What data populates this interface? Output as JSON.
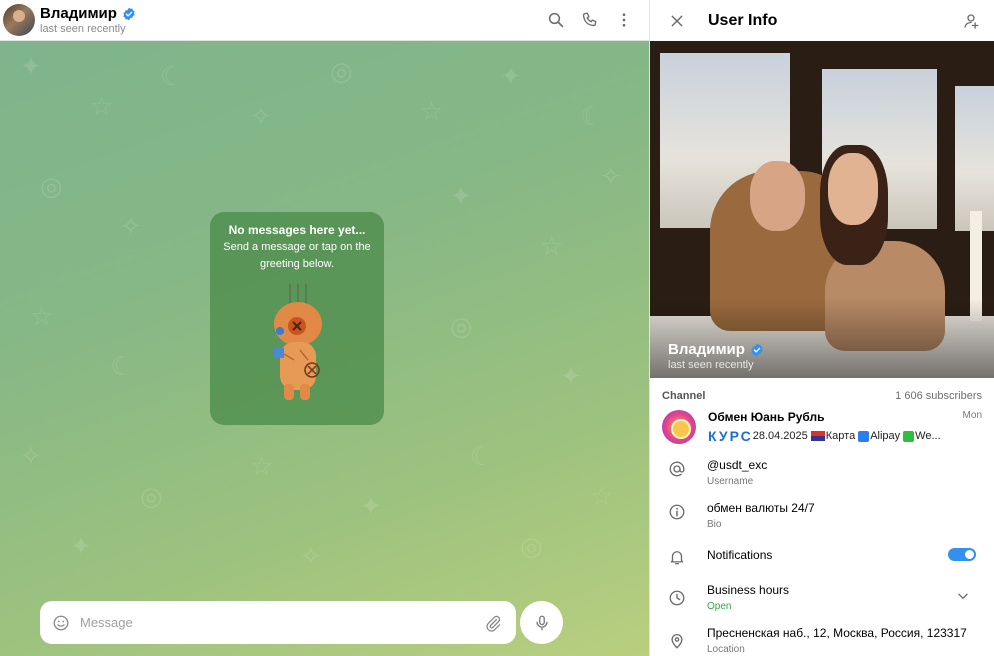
{
  "chat": {
    "name": "Владимир",
    "status": "last seen recently",
    "empty_title": "No messages here yet...",
    "empty_subtitle": "Send a message or tap on the greeting below.",
    "message_placeholder": "Message"
  },
  "info_panel": {
    "title": "User Info",
    "photo_name": "Владимир",
    "photo_status": "last seen recently",
    "channel": {
      "label": "Channel",
      "subscribers": "1 606 subscribers",
      "name": "Обмен Юань Рубль",
      "time": "Mon",
      "preview_prefix": "КУРС",
      "preview_date": "28.04.2025",
      "preview_card": "Карта",
      "preview_alipay": "Alipay",
      "preview_we": "We..."
    },
    "rows": {
      "username_value": "@usdt_exc",
      "username_label": "Username",
      "bio_value": "обмен валюты 24/7",
      "bio_label": "Bio",
      "notifications_value": "Notifications",
      "notifications_on": true,
      "business_value": "Business hours",
      "business_label": "Open",
      "location_value": "Пресненская наб., 12, Москва, Россия, 123317",
      "location_label": "Location"
    }
  },
  "colors": {
    "accent": "#3390ec",
    "verified": "#3390ec",
    "open_status": "#2eaa3f",
    "wallpaper_top": "#7fb48c",
    "wallpaper_bottom": "#b9cf7f",
    "kurs_text": "#1f6fd1"
  },
  "icons": [
    "search-icon",
    "phone-icon",
    "more-vertical-icon",
    "close-icon",
    "edit-contact-icon",
    "emoji-icon",
    "attach-icon",
    "mic-icon",
    "at-icon",
    "info-icon",
    "bell-icon",
    "clock-icon",
    "location-pin-icon",
    "chevron-down-icon",
    "verified-icon"
  ]
}
